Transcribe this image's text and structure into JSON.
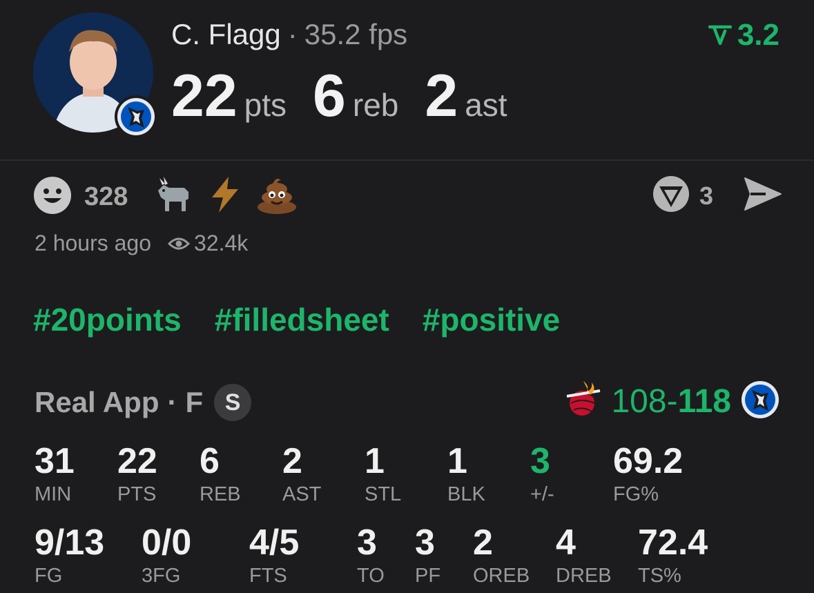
{
  "player": {
    "name": "C. Flagg",
    "fps": "35.2 fps",
    "rating": "3.2",
    "pts": "22",
    "pts_unit": "pts",
    "reb": "6",
    "reb_unit": "reb",
    "ast": "2",
    "ast_unit": "ast"
  },
  "reactions": {
    "count": "328",
    "emojis": [
      "goat-emoji",
      "lightning-emoji",
      "poop-emoji"
    ],
    "comments": "3"
  },
  "meta": {
    "time": "2 hours ago",
    "views": "32.4k"
  },
  "tags": [
    "#20points",
    "#filledsheet",
    "#positive"
  ],
  "game": {
    "source": "Real App",
    "position": "F",
    "badge": "S",
    "away_score": "108",
    "dash": "-",
    "home_score": "118"
  },
  "stats_row1": [
    {
      "val": "31",
      "lab": "MIN"
    },
    {
      "val": "22",
      "lab": "PTS"
    },
    {
      "val": "6",
      "lab": "REB"
    },
    {
      "val": "2",
      "lab": "AST"
    },
    {
      "val": "1",
      "lab": "STL"
    },
    {
      "val": "1",
      "lab": "BLK"
    },
    {
      "val": "3",
      "lab": "+/-"
    },
    {
      "val": "69.2",
      "lab": "FG%"
    }
  ],
  "stats_row2": [
    {
      "val": "9/13",
      "lab": "FG"
    },
    {
      "val": "0/0",
      "lab": "3FG"
    },
    {
      "val": "4/5",
      "lab": "FTS"
    },
    {
      "val": "3",
      "lab": "TO"
    },
    {
      "val": "3",
      "lab": "PF"
    },
    {
      "val": "2",
      "lab": "OREB"
    },
    {
      "val": "4",
      "lab": "DREB"
    },
    {
      "val": "72.4",
      "lab": "TS%"
    }
  ],
  "colors": {
    "accent": "#1db56a",
    "background": "#1c1c1e",
    "muted": "#9a9a9a"
  }
}
